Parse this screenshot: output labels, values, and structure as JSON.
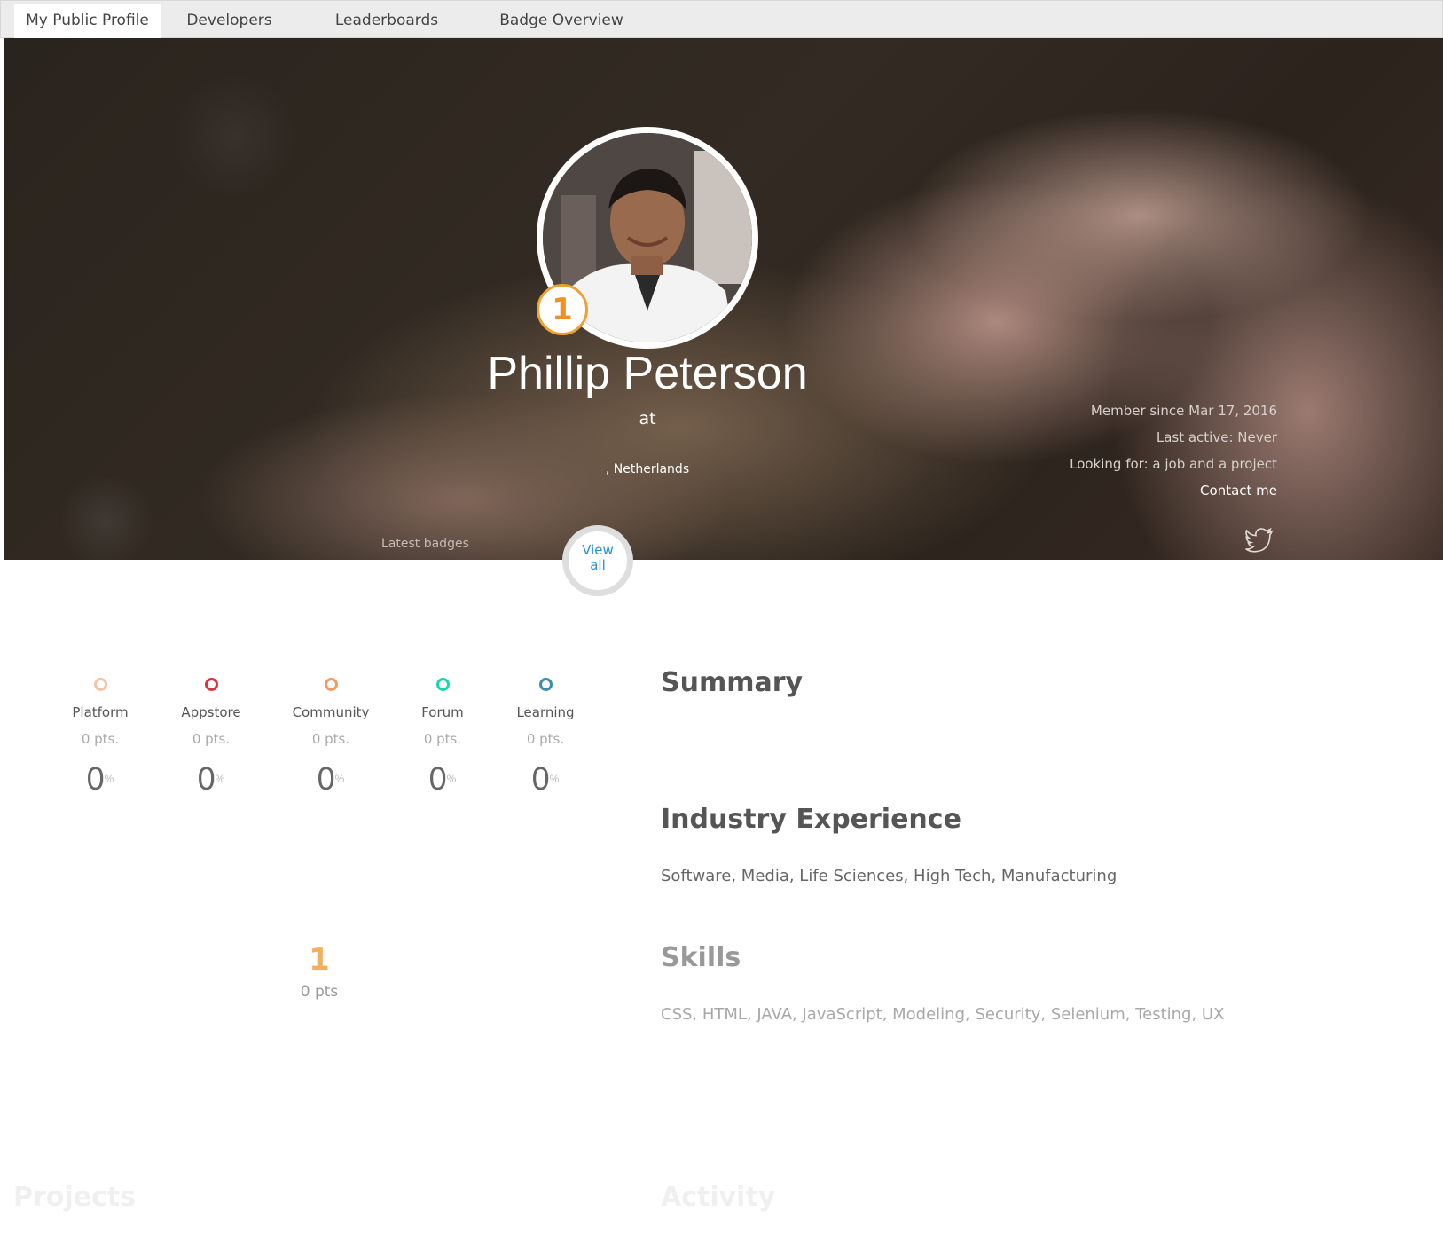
{
  "tabs": [
    {
      "label": "My Public Profile",
      "active": true
    },
    {
      "label": "Developers"
    },
    {
      "label": "Leaderboards"
    },
    {
      "label": "Badge Overview"
    }
  ],
  "profile": {
    "name": "Phillip Peterson",
    "at_text": "at",
    "location": ", Netherlands",
    "rank": "1",
    "member_since": "Member since Mar 17, 2016",
    "last_active": "Last active: Never",
    "looking_for": "Looking for: a job and a project",
    "contact_label": "Contact me",
    "twitter_icon": "twitter-icon"
  },
  "badges": {
    "latest_label": "Latest badges",
    "view_all_line1": "View",
    "view_all_line2": "all"
  },
  "stats": [
    {
      "label": "Platform",
      "pts": "0 pts.",
      "pct": "0",
      "pct_sign": "%",
      "color": "#f6c3a8"
    },
    {
      "label": "Appstore",
      "pts": "0 pts.",
      "pct": "0",
      "pct_sign": "%",
      "color": "#e0323a"
    },
    {
      "label": "Community",
      "pts": "0 pts.",
      "pct": "0",
      "pct_sign": "%",
      "color": "#f49a62"
    },
    {
      "label": "Forum",
      "pts": "0 pts.",
      "pct": "0",
      "pct_sign": "%",
      "color": "#17d8a8"
    },
    {
      "label": "Learning",
      "pts": "0 pts.",
      "pct": "0",
      "pct_sign": "%",
      "color": "#3b8fae"
    }
  ],
  "points": {
    "level": "1",
    "total": "0 pts"
  },
  "sections": {
    "summary_title": "Summary",
    "industry_title": "Industry Experience",
    "industry_text": "Software, Media, Life Sciences, High Tech, Manufacturing",
    "skills_title": "Skills",
    "skills_text": "CSS, HTML, JAVA, JavaScript, Modeling, Security, Selenium, Testing, UX",
    "projects_title": "Projects",
    "activity_title": "Activity"
  }
}
